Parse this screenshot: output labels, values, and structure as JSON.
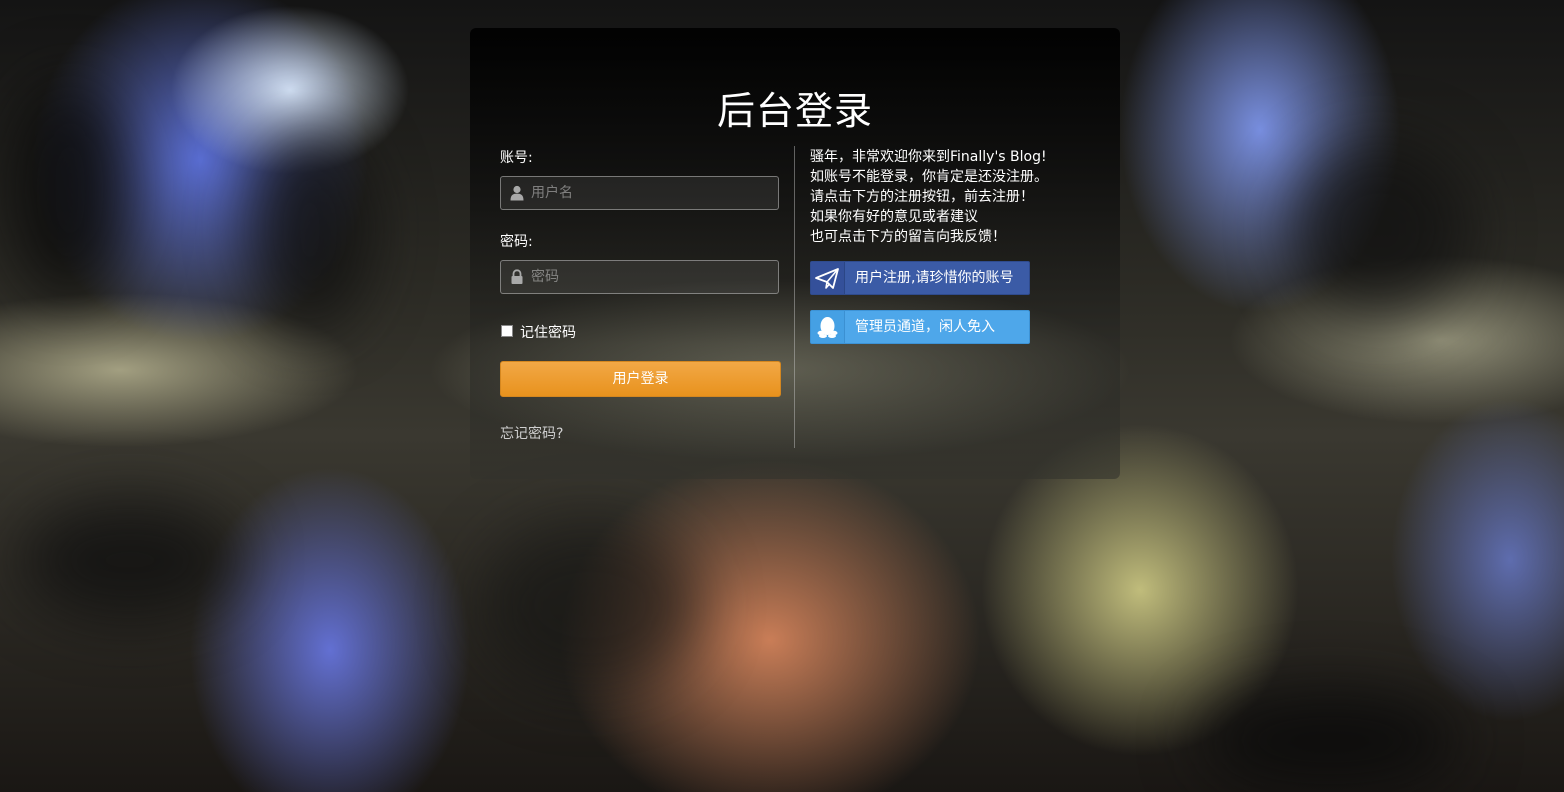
{
  "page": {
    "title": "后台登录"
  },
  "login_form": {
    "account_label": "账号:",
    "username_placeholder": "用户名",
    "username_value": "",
    "password_label": "密码:",
    "password_placeholder": "密码",
    "password_value": "",
    "remember_label": "记住密码",
    "login_button": "用户登录",
    "forgot_link": "忘记密码?"
  },
  "info": {
    "lines": [
      "骚年，非常欢迎你来到Finally's Blog!",
      "如账号不能登录，你肯定是还没注册。",
      "请点击下方的注册按钮，前去注册！",
      "如果你有好的意见或者建议",
      "也可点击下方的留言向我反馈！"
    ],
    "register_button": "用户注册,请珍惜你的账号",
    "admin_button": "管理员通道，闲人免入"
  },
  "colors": {
    "login_button": "#ee9d30",
    "register_button": "#3b5ba6",
    "admin_button": "#4ea7ea"
  },
  "icons": {
    "username": "user-icon",
    "password": "lock-icon",
    "register": "paper-plane-icon",
    "admin": "qq-penguin-icon"
  }
}
